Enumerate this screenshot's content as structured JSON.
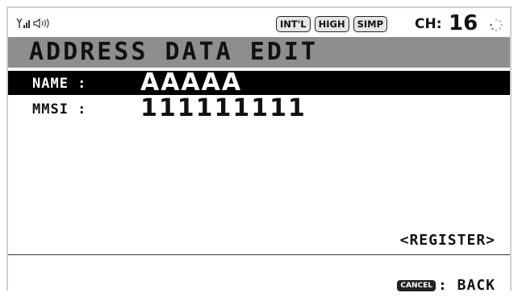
{
  "status_bar": {
    "icons": [
      "antenna-signal-icon",
      "speaker-icon",
      "busy-spinner-icon"
    ],
    "badges": [
      "INT'L",
      "HIGH",
      "SIMP"
    ],
    "channel_label": "CH:",
    "channel_value": "16"
  },
  "title": "ADDRESS DATA EDIT",
  "fields": {
    "name": {
      "label": "NAME :",
      "value": "AAAAA"
    },
    "mmsi": {
      "label": "MMSI :",
      "value": "111111111"
    }
  },
  "register_label": "<REGISTER>",
  "footer": {
    "key_label": "CANCEL",
    "action_label": ": BACK"
  },
  "colors": {
    "title_bar": "#8e8e8e",
    "selected_row": "#000000",
    "text": "#111111"
  }
}
